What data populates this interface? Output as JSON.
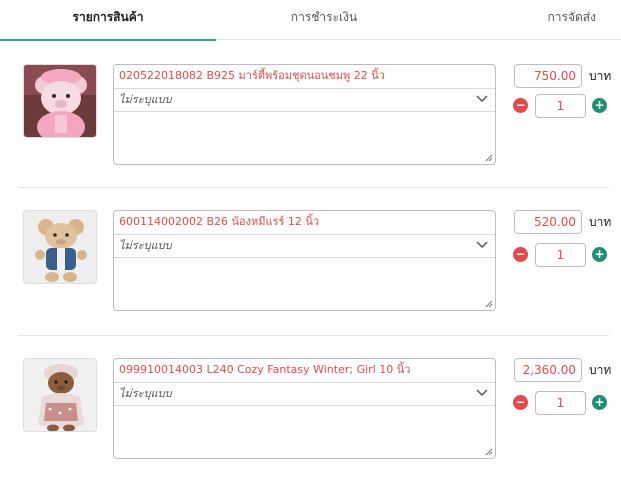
{
  "tabs": [
    {
      "label": "รายการสินค้า"
    },
    {
      "label": "การชำระเงิน"
    },
    {
      "label": "การจัดส่ง"
    }
  ],
  "items": [
    {
      "name": "020522018082 B925 มาร์ตี้พร้อมชุดนอนชมพู 22 นิ้ว",
      "variant": "ไม่ระบุแบบ",
      "price": "750.00",
      "unit": "บาท",
      "qty": "1",
      "thumb": "pink-teddy-bear"
    },
    {
      "name": "600114002002 B26 น้องหมีแรร์ 12 นิ้ว",
      "variant": "ไม่ระบุแบบ",
      "price": "520.00",
      "unit": "บาท",
      "qty": "1",
      "thumb": "blue-vest-teddy-bear"
    },
    {
      "name": "099910014003 L240 Cozy Fantasy Winter; Girl 10 นิ้ว",
      "variant": "ไม่ระบุแบบ",
      "price": "2,360.00",
      "unit": "บาท",
      "qty": "1",
      "thumb": "winter-girl-teddy-bear"
    }
  ],
  "icons": {
    "minus": "−",
    "plus": "+",
    "variant_dropdown": "chevron-down-icon",
    "resize": "resize-handle-icon"
  },
  "colors": {
    "accent": "#2aa89a",
    "product_text": "#e34b4b",
    "minus": "#e24a4a",
    "plus": "#1f8f73"
  }
}
